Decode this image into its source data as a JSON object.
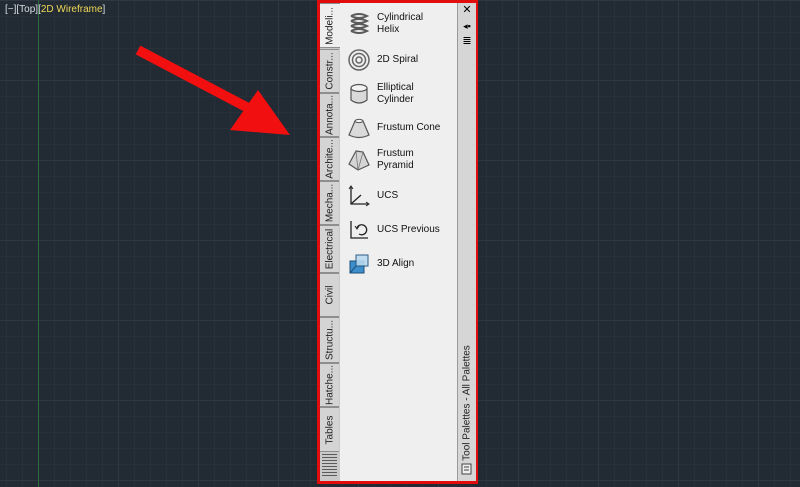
{
  "viewport": {
    "label_prefix": "[−][Top][",
    "mode": "2D Wireframe",
    "label_suffix": "]"
  },
  "palette": {
    "title": "Tool Palettes - All Palettes",
    "tabs": [
      "Modeli...",
      "Constr...",
      "Annota...",
      "Archite...",
      "Mecha...",
      "Electrical",
      "Civil",
      "Structu...",
      "Hatche...",
      "Tables"
    ],
    "items": [
      {
        "line1": "Cylindrical",
        "line2": "Helix",
        "icon": "cylindrical-helix-icon"
      },
      {
        "line1": "2D Spiral",
        "line2": "",
        "icon": "2d-spiral-icon"
      },
      {
        "line1": "Elliptical",
        "line2": "Cylinder",
        "icon": "elliptical-cylinder-icon"
      },
      {
        "line1": "Frustum Cone",
        "line2": "",
        "icon": "frustum-cone-icon"
      },
      {
        "line1": "Frustum",
        "line2": "Pyramid",
        "icon": "frustum-pyramid-icon"
      },
      {
        "line1": "UCS",
        "line2": "",
        "icon": "ucs-icon"
      },
      {
        "line1": "UCS Previous",
        "line2": "",
        "icon": "ucs-previous-icon"
      },
      {
        "line1": "3D Align",
        "line2": "",
        "icon": "3d-align-icon"
      }
    ],
    "controls": {
      "close": "✕",
      "autohide": "◂▪",
      "properties": "≣"
    }
  },
  "colors": {
    "highlight_border": "#e10d0d",
    "arrow": "#f20f0f",
    "viewport_mode": "#f0d858"
  }
}
